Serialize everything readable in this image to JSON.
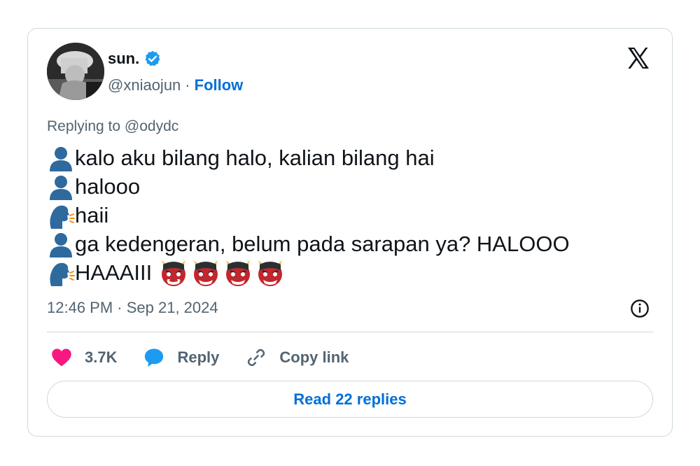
{
  "author": {
    "display_name": "sun.",
    "handle": "@xniaojun",
    "separator": "·",
    "follow_label": "Follow",
    "verified": true,
    "verified_color": "#1d9bf0"
  },
  "reply_to": {
    "prefix": "Replying to",
    "mention": "@odydc"
  },
  "tweet": {
    "lines": [
      {
        "emoji": "bust-in-silhouette",
        "text": "kalo aku bilang halo, kalian bilang hai"
      },
      {
        "emoji": "bust-in-silhouette",
        "text": " halooo"
      },
      {
        "emoji": "speaking-head",
        "text": " haii"
      },
      {
        "emoji": "bust-in-silhouette",
        "text": " ga kedengeran, belum pada sarapan ya? HALOOO"
      },
      {
        "emoji": "speaking-head",
        "text": " HAAAIII",
        "trailing_emoji": [
          "ogre",
          "ogre",
          "ogre",
          "ogre"
        ]
      }
    ]
  },
  "timestamp": "12:46 PM · Sep 21, 2024",
  "actions": {
    "likes_count": "3.7K",
    "reply_label": "Reply",
    "copy_link_label": "Copy link"
  },
  "read_replies_label": "Read 22 replies",
  "colors": {
    "link": "#006fd6",
    "muted": "#536471",
    "like": "#f91880",
    "reply": "#1d9bf0",
    "border": "#cfd9de"
  },
  "icons": {
    "brand": "x-logo-icon",
    "info": "info-icon",
    "like": "heart-icon",
    "reply": "speech-bubble-icon",
    "copy": "link-icon"
  }
}
